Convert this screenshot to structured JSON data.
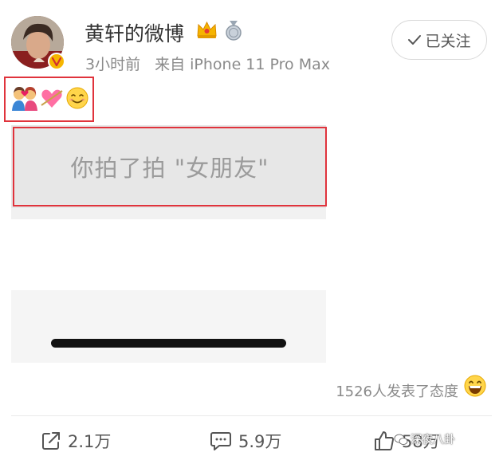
{
  "post": {
    "username": "黄轩的微博",
    "time": "3小时前",
    "source": "来自 iPhone 11 Pro Max",
    "follow_label": "已关注",
    "content_emojis": [
      "couple-with-heart-emoji",
      "heart-with-arrow-emoji",
      "smiling-face-emoji"
    ],
    "pat_notice": "你拍了拍 \"女朋友\"",
    "reactions_text": "1526人发表了态度"
  },
  "actions": {
    "repost_count": "2.1万",
    "comment_count": "5.9万",
    "like_count": "58万"
  },
  "watermark": "深夜八卦",
  "colors": {
    "annotation_red": "#e0333c",
    "verified_gold": "#f6b600",
    "text_gray": "#8a8a8a",
    "placeholder_gray": "#e7e7e7"
  }
}
